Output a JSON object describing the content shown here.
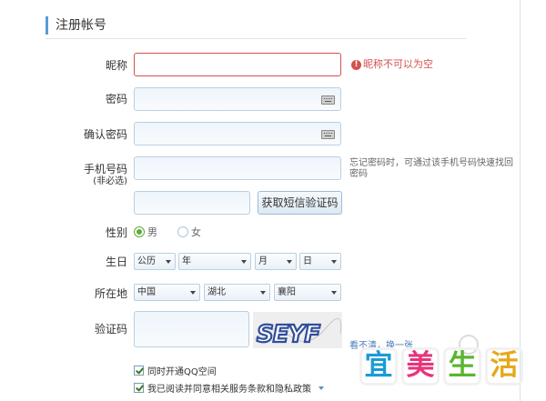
{
  "section": {
    "title": "注册帐号"
  },
  "nickname": {
    "label": "昵称",
    "value": "",
    "error": "昵称不可以为空"
  },
  "password": {
    "label": "密码",
    "value": ""
  },
  "confirm_password": {
    "label": "确认密码",
    "value": ""
  },
  "phone": {
    "label": "手机号码",
    "sublabel": "(非必选)",
    "value": "",
    "hint": "忘记密码时，可通过该手机号码快速找回密码"
  },
  "sms": {
    "code_value": "",
    "button_label": "获取短信验证码"
  },
  "gender": {
    "label": "性别",
    "options": [
      "男",
      "女"
    ],
    "selected": "男"
  },
  "birthday": {
    "label": "生日",
    "calendar": "公历",
    "year": "年",
    "month": "月",
    "day": "日"
  },
  "location": {
    "label": "所在地",
    "country": "中国",
    "province": "湖北",
    "city": "襄阳"
  },
  "captcha": {
    "label": "验证码",
    "value": "",
    "image_text": "SEYF",
    "refresh_label": "看不清，换一张"
  },
  "options": {
    "qzone_label": "同时开通QQ空间",
    "qzone_checked": true,
    "terms_label": "我已阅读并同意相关服务条款和隐私政策",
    "terms_checked": true
  },
  "watermark": {
    "chars": [
      "宜",
      "美",
      "生",
      "活"
    ],
    "colors": [
      "#1a9bd7",
      "#e8347c",
      "#5bb531",
      "#e6a817"
    ]
  }
}
